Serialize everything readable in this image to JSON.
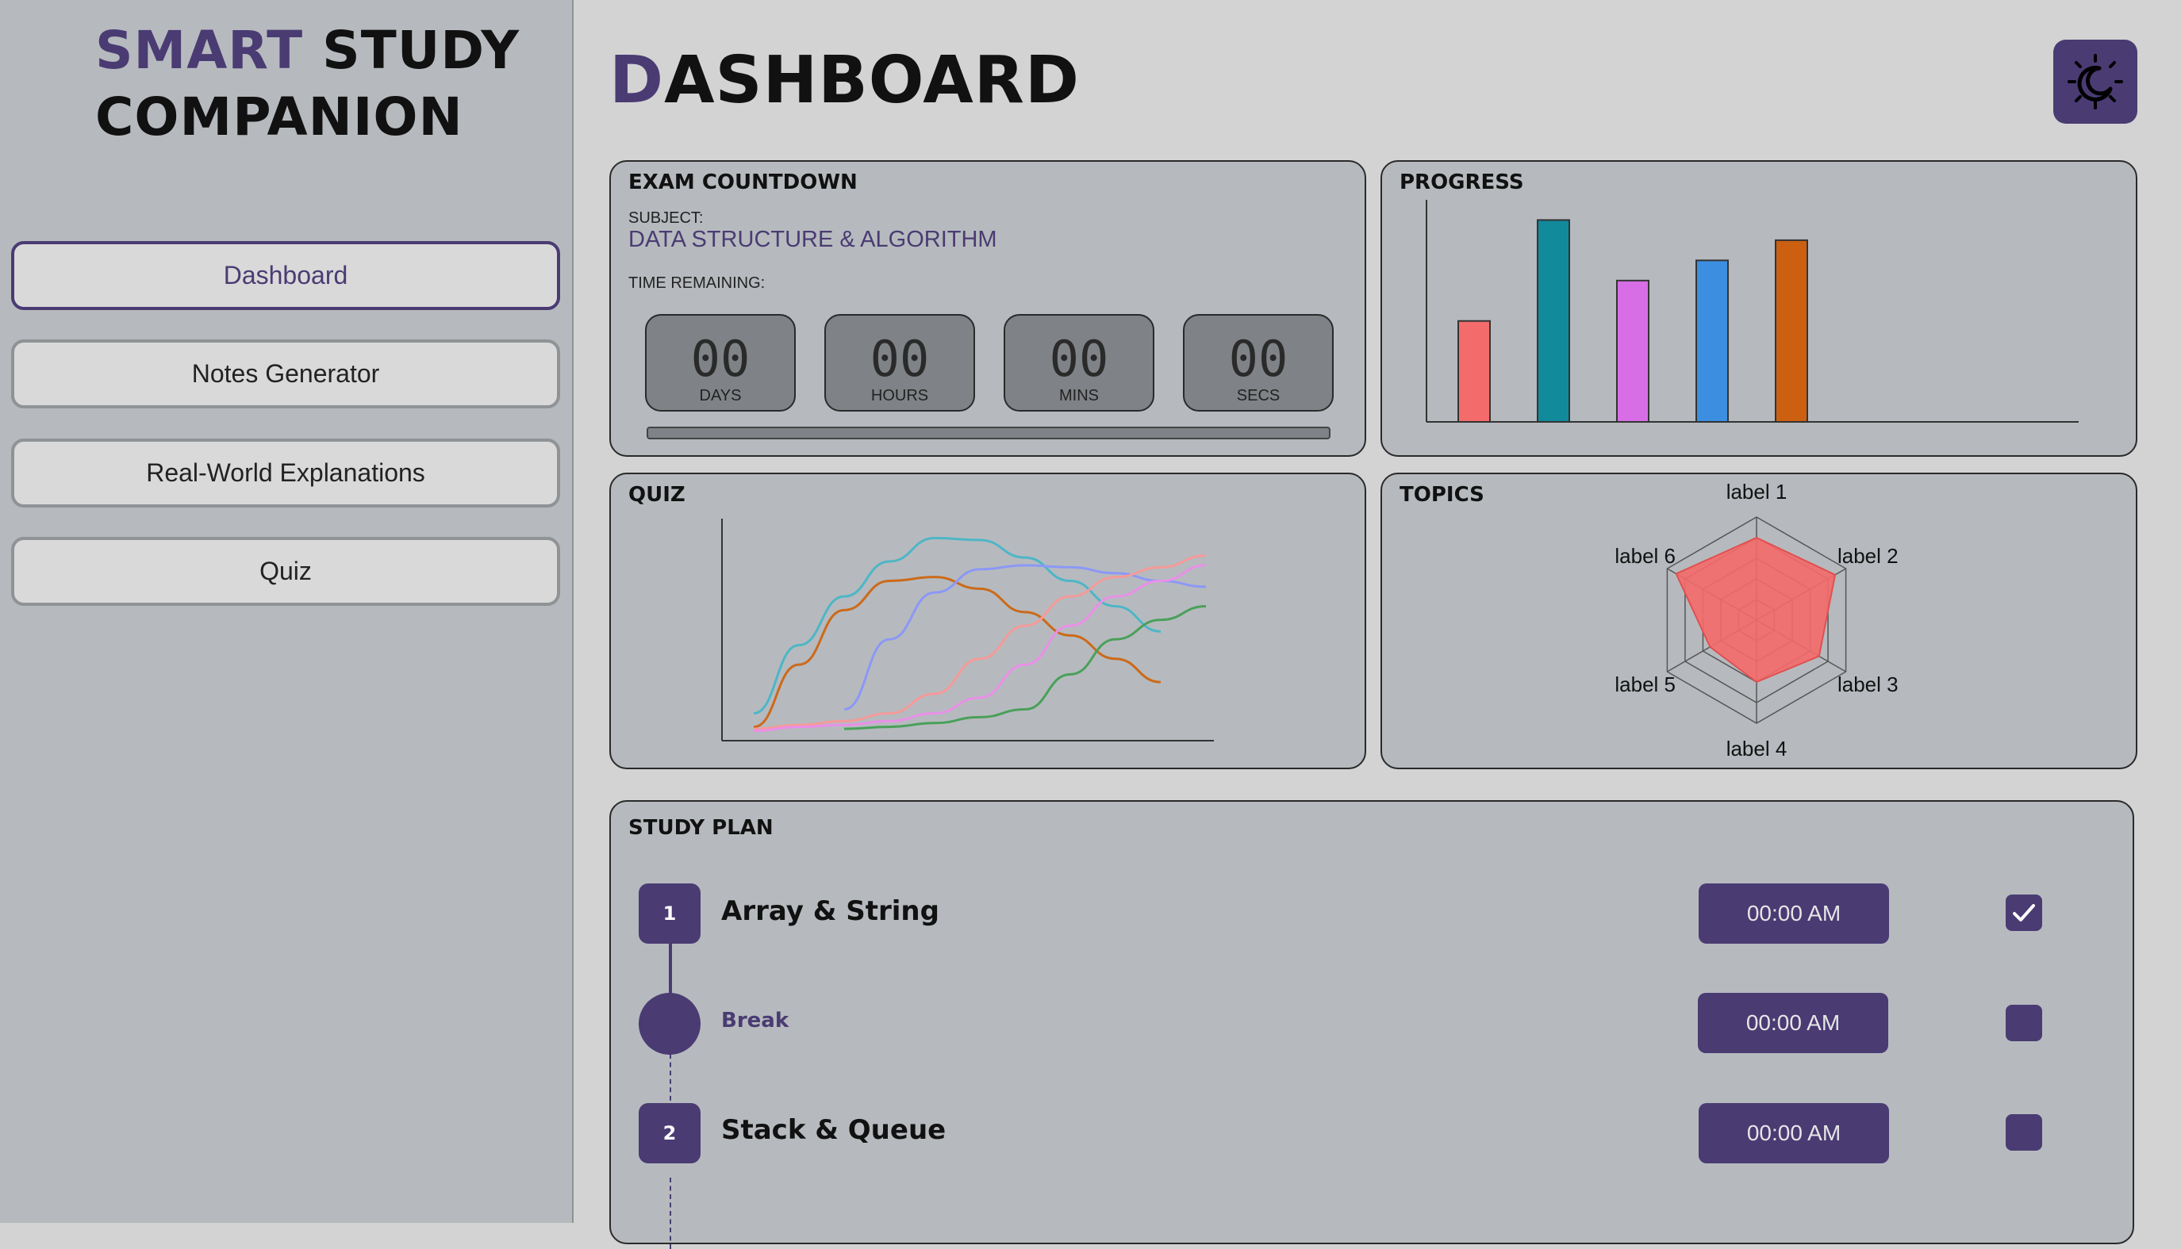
{
  "sidebar": {
    "brand": {
      "line1_accent": "SMART",
      "line1_rest": "STUDY",
      "line2": "COMPANION"
    },
    "nav": [
      {
        "label": "Dashboard",
        "active": true
      },
      {
        "label": "Notes Generator",
        "active": false
      },
      {
        "label": "Real-World Explanations",
        "active": false
      },
      {
        "label": "Quiz",
        "active": false
      }
    ]
  },
  "header": {
    "title_first": "D",
    "title_rest": "ASHBOARD",
    "theme_icon": "moon-icon"
  },
  "countdown": {
    "title": "EXAM COUNTDOWN",
    "subject_label": "SUBJECT:",
    "subject": "DATA STRUCTURE & ALGORITHM",
    "time_label": "TIME REMAINING:",
    "units": [
      {
        "value": "00",
        "label": "DAYS"
      },
      {
        "value": "00",
        "label": "HOURS"
      },
      {
        "value": "00",
        "label": "MINS"
      },
      {
        "value": "00",
        "label": "SECS"
      }
    ],
    "progress": 0
  },
  "progress_card": {
    "title": "PROGRESS"
  },
  "quiz_card": {
    "title": "QUIZ"
  },
  "topics_card": {
    "title": "TOPICS"
  },
  "chart_data": [
    {
      "type": "bar",
      "categories": [
        "",
        "",
        "",
        "",
        ""
      ],
      "values": [
        50,
        100,
        70,
        80,
        90
      ],
      "colors": [
        "#f36b6b",
        "#118a9b",
        "#d76ee5",
        "#3c8fe0",
        "#cc6010"
      ],
      "ylim": [
        0,
        110
      ]
    },
    {
      "type": "line",
      "x": [
        0,
        1,
        2,
        3,
        4,
        5,
        6,
        7,
        8,
        9,
        10
      ],
      "series": [
        {
          "color": "#4db6c7",
          "values": [
            10,
            45,
            70,
            88,
            100,
            99,
            90,
            78,
            65,
            52,
            null
          ]
        },
        {
          "color": "#cc6a1a",
          "values": [
            3,
            35,
            63,
            78,
            80,
            74,
            62,
            50,
            38,
            26,
            null
          ]
        },
        {
          "color": "#8c98f6",
          "values": [
            null,
            null,
            12,
            48,
            72,
            84,
            86,
            85,
            82,
            78,
            75
          ]
        },
        {
          "color": "#f59a9a",
          "values": [
            2,
            4,
            6,
            10,
            20,
            38,
            55,
            70,
            80,
            85,
            91
          ]
        },
        {
          "color": "#ea8fe8",
          "values": [
            1,
            3,
            4,
            6,
            10,
            18,
            35,
            55,
            70,
            78,
            86
          ]
        },
        {
          "color": "#4aa05a",
          "values": [
            null,
            null,
            2,
            3,
            5,
            8,
            12,
            30,
            48,
            58,
            65
          ]
        }
      ],
      "ylim": [
        0,
        110
      ]
    },
    {
      "type": "radar",
      "axes": [
        "label 1",
        "label 2",
        "label 3",
        "label 4",
        "label 5",
        "label 6"
      ],
      "values": [
        0.8,
        0.88,
        0.7,
        0.6,
        0.52,
        0.9
      ],
      "max": 1,
      "rings": 5,
      "fill": "#f56a6a"
    }
  ],
  "study_plan": {
    "title": "STUDY PLAN",
    "items": [
      {
        "number": "1",
        "name": "Array & String",
        "time": "00:00 AM",
        "checked": true
      },
      {
        "name": "Break",
        "time": "00:00 AM",
        "checked": false
      },
      {
        "number": "2",
        "name": "Stack & Queue",
        "time": "00:00 AM",
        "checked": false
      }
    ]
  }
}
